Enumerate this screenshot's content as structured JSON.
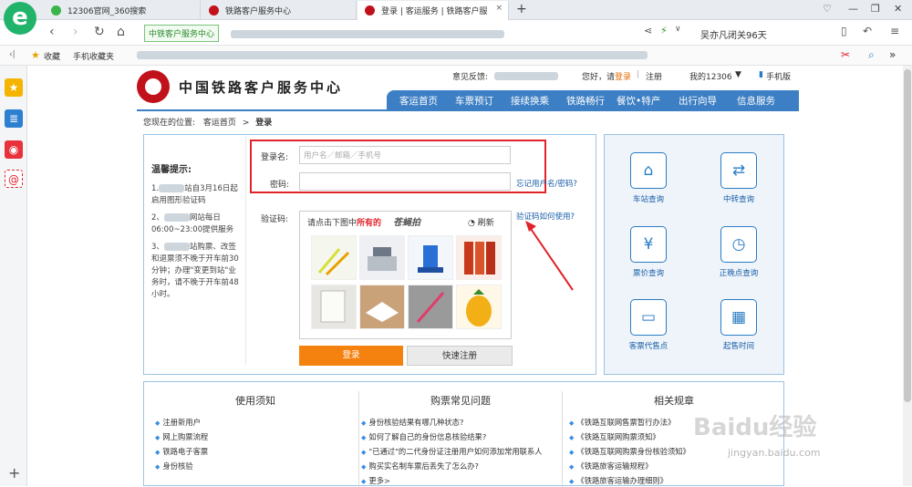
{
  "browser": {
    "tabs": [
      {
        "label": "12306官网_360搜索"
      },
      {
        "label": "铁路客户服务中心"
      },
      {
        "label": "登录 | 客运服务 | 铁路客户服"
      }
    ],
    "address_site": "中铁客户服务中心",
    "user_label": "吴亦凡闭关96天",
    "bookmarks": {
      "fav": "收藏",
      "mobile": "手机收藏夹"
    }
  },
  "site": {
    "title": "中国铁路客户服务中心",
    "top_links": {
      "feedback": "意见反馈:",
      "hello": "您好，请",
      "login": "登录",
      "register": "注册",
      "my12306": "我的12306",
      "mobile": "手机版"
    },
    "menu": [
      "客运首页",
      "车票预订",
      "接续换乘",
      "铁路畅行",
      "餐饮•特产",
      "出行向导",
      "信息服务"
    ],
    "breadcrumb": {
      "prefix": "您现在的位置:",
      "home": "客运首页",
      "sep": ">",
      "current": "登录"
    }
  },
  "tips": {
    "title": "温馨提示:",
    "items": [
      "1.",
      "站自3月16日起启用图形验证码",
      "2、",
      "网站每日06:00~23:00提供服务",
      "3、",
      "站购票、改签和退票须不晚于开车前30分钟；办理\"变更到站\"业务时，请不晚于开车前48小时。"
    ]
  },
  "login": {
    "username_label": "登录名:",
    "username_placeholder": "用户名／邮箱／手机号",
    "password_label": "密码:",
    "forgot": "忘记用户名/密码?",
    "captcha_label": "验证码:",
    "captcha_help": "验证码如何使用?",
    "captcha_prompt_a": "请点击下图中",
    "captcha_prompt_b": "所有的",
    "captcha_word": "苍蝇拍",
    "refresh": "刷新",
    "login_btn": "登录",
    "register_btn": "快速注册"
  },
  "services": [
    {
      "label": "车站查询",
      "icon": "station-icon"
    },
    {
      "label": "中转查询",
      "icon": "transfer-icon"
    },
    {
      "label": "票价查询",
      "icon": "price-icon"
    },
    {
      "label": "正晚点查询",
      "icon": "clock-icon"
    },
    {
      "label": "客票代售点",
      "icon": "ticket-agent-icon"
    },
    {
      "label": "起售时间",
      "icon": "sale-time-icon"
    }
  ],
  "bottom": {
    "col1": {
      "title": "使用须知",
      "items": [
        "注册新用户",
        "网上购票流程",
        "铁路电子客票",
        "身份核验"
      ]
    },
    "col2": {
      "title": "购票常见问题",
      "items": [
        "身份核验结果有哪几种状态?",
        "如何了解自己的身份信息核验结果?",
        "\"已通过\"的二代身份证注册用户如何添加常用联系人",
        "购买实名制车票后丢失了怎么办?",
        "更多>"
      ]
    },
    "col3": {
      "title": "相关规章",
      "items": [
        "《铁路互联网售票暂行办法》",
        "《铁路互联网购票须知》",
        "《铁路互联网购票身份核验须知》",
        "《铁路旅客运输规程》",
        "《铁路旅客运输办理细则》"
      ]
    }
  },
  "watermark": {
    "main": "Baidu经验",
    "sub": "jingyan.baidu.com"
  },
  "colors": {
    "brand_red": "#c1121c",
    "menu_blue": "#3d7fc4",
    "login_orange": "#f5820f",
    "highlight_red": "#e2232a"
  }
}
